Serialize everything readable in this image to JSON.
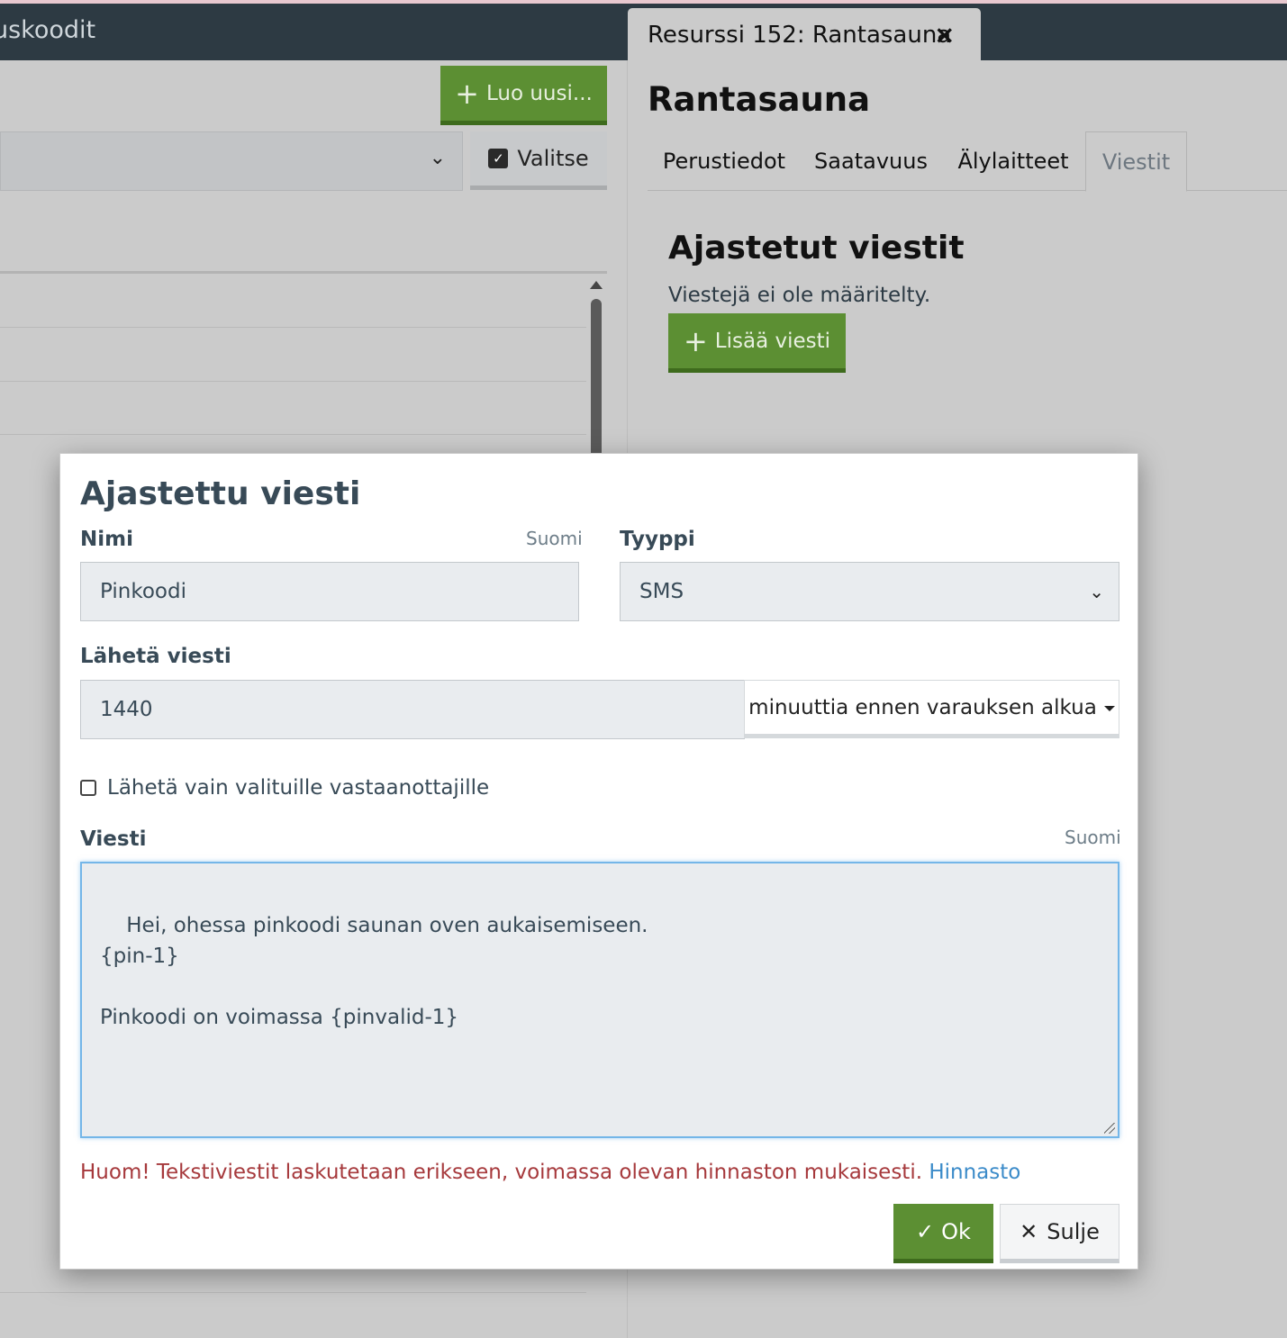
{
  "topbar": {
    "title_fragment": "uskoodit",
    "tab": {
      "label": "Resurssi 152: Rantasauna",
      "close_icon": "×"
    }
  },
  "left_panel": {
    "create_button": {
      "icon": "+",
      "label": "Luo uusi..."
    },
    "select": {
      "value": "",
      "chevron": "⌄"
    },
    "select_toggle": {
      "icon": "✓",
      "label": "Valitse"
    }
  },
  "right_panel": {
    "title": "Rantasauna",
    "tabs": [
      {
        "label": "Perustiedot",
        "active": false
      },
      {
        "label": "Saatavuus",
        "active": false
      },
      {
        "label": "Älylaitteet",
        "active": false
      },
      {
        "label": "Viestit",
        "active": true
      }
    ],
    "section_title": "Ajastetut viestit",
    "empty_text": "Viestejä ei ole määritelty.",
    "add_button": {
      "icon": "+",
      "label": "Lisää viesti"
    }
  },
  "modal": {
    "title": "Ajastettu viesti",
    "name": {
      "label": "Nimi",
      "language": "Suomi",
      "value": "Pinkoodi"
    },
    "type": {
      "label": "Tyyppi",
      "value": "SMS",
      "chevron": "⌄"
    },
    "send": {
      "label": "Lähetä viesti",
      "value": "1440",
      "unit": "minuuttia ennen varauksen alkua"
    },
    "only_selected": {
      "label": "Lähetä vain valituille vastaanottajille",
      "checked": false
    },
    "message": {
      "label": "Viesti",
      "language": "Suomi",
      "value": "Hei, ohessa pinkoodi saunan oven aukaisemiseen.\n{pin-1}\n\nPinkoodi on voimassa {pinvalid-1}"
    },
    "warning": {
      "text": "Huom! Tekstiviestit laskutetaan erikseen, voimassa olevan hinnaston mukaisesti.",
      "link": "Hinnasto"
    },
    "ok_button": {
      "icon": "✓",
      "label": "Ok"
    },
    "close_button": {
      "icon": "✕",
      "label": "Sulje"
    }
  },
  "colors": {
    "topbar": "#2d3a43",
    "primary_green": "#5c8f33",
    "warning_red": "#a6393c",
    "link_blue": "#3b8bc9",
    "focus_blue": "#74b6e8"
  }
}
